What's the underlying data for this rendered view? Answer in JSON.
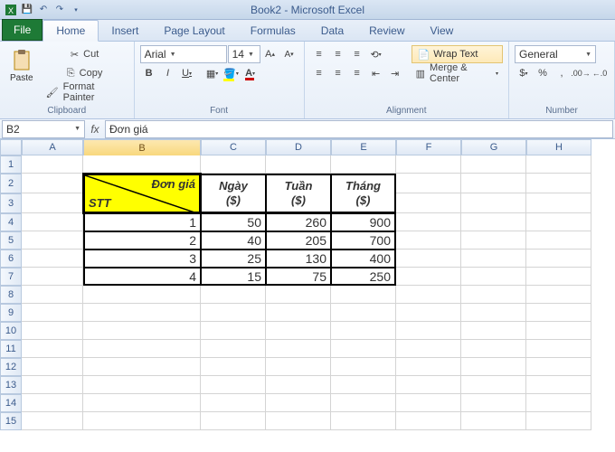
{
  "app": {
    "title": "Book2 - Microsoft Excel"
  },
  "tabs": {
    "file": "File",
    "home": "Home",
    "insert": "Insert",
    "pageLayout": "Page Layout",
    "formulas": "Formulas",
    "data": "Data",
    "review": "Review",
    "view": "View"
  },
  "clipboard": {
    "cut": "Cut",
    "copy": "Copy",
    "formatPainter": "Format Painter",
    "label": "Clipboard",
    "paste": "Paste"
  },
  "font": {
    "name": "Arial",
    "size": "14",
    "label": "Font"
  },
  "alignment": {
    "wrap": "Wrap Text",
    "merge": "Merge & Center",
    "label": "Alignment"
  },
  "number": {
    "format": "General",
    "label": "Number"
  },
  "namebox": "B2",
  "fx": "fx",
  "fbar": "Đơn giá",
  "cols": [
    "A",
    "B",
    "C",
    "D",
    "E",
    "F",
    "G",
    "H"
  ],
  "table": {
    "cornerTop": "Đơn giá",
    "cornerBottom": "STT",
    "headers": [
      "Ngày ($)",
      "Tuần ($)",
      "Tháng ($)"
    ],
    "stt": [
      "1",
      "2",
      "3",
      "4"
    ],
    "rows": [
      [
        "50",
        "260",
        "900"
      ],
      [
        "40",
        "205",
        "700"
      ],
      [
        "25",
        "130",
        "400"
      ],
      [
        "15",
        "75",
        "250"
      ]
    ]
  }
}
